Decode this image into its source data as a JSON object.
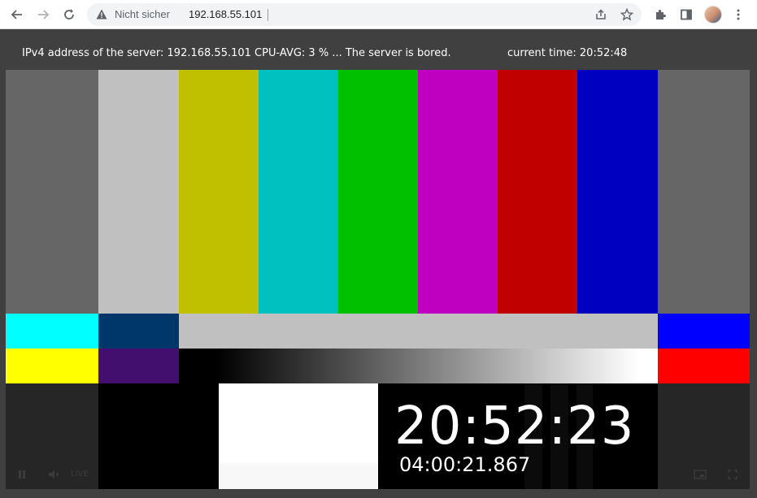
{
  "browser": {
    "security_label": "Nicht sicher",
    "url": "192.168.55.101"
  },
  "header": {
    "server_info": "IPv4 address of the server: 192.168.55.101  CPU-AVG: 3 % ... The server is bored.",
    "current_time": "current time: 20:52:48"
  },
  "video": {
    "clock_time": "20:52:23",
    "timecode": "04:00:21.867",
    "live_label": "LIVE"
  },
  "colors": {
    "top_bars": [
      "#666666",
      "#c0c0c0",
      "#c0c000",
      "#00c0c0",
      "#00c000",
      "#c000c0",
      "#c00000",
      "#0000c0",
      "#666666"
    ],
    "middle_row": [
      "#00ffff",
      "#00376b",
      "#c0c0c0",
      "#0000ff"
    ],
    "gray_row": [
      "#ffff00",
      "#420f6f",
      "gradient",
      "#ff0000"
    ],
    "bottom_row": [
      "#262626",
      "#000000",
      "#000000",
      "#262626"
    ]
  }
}
